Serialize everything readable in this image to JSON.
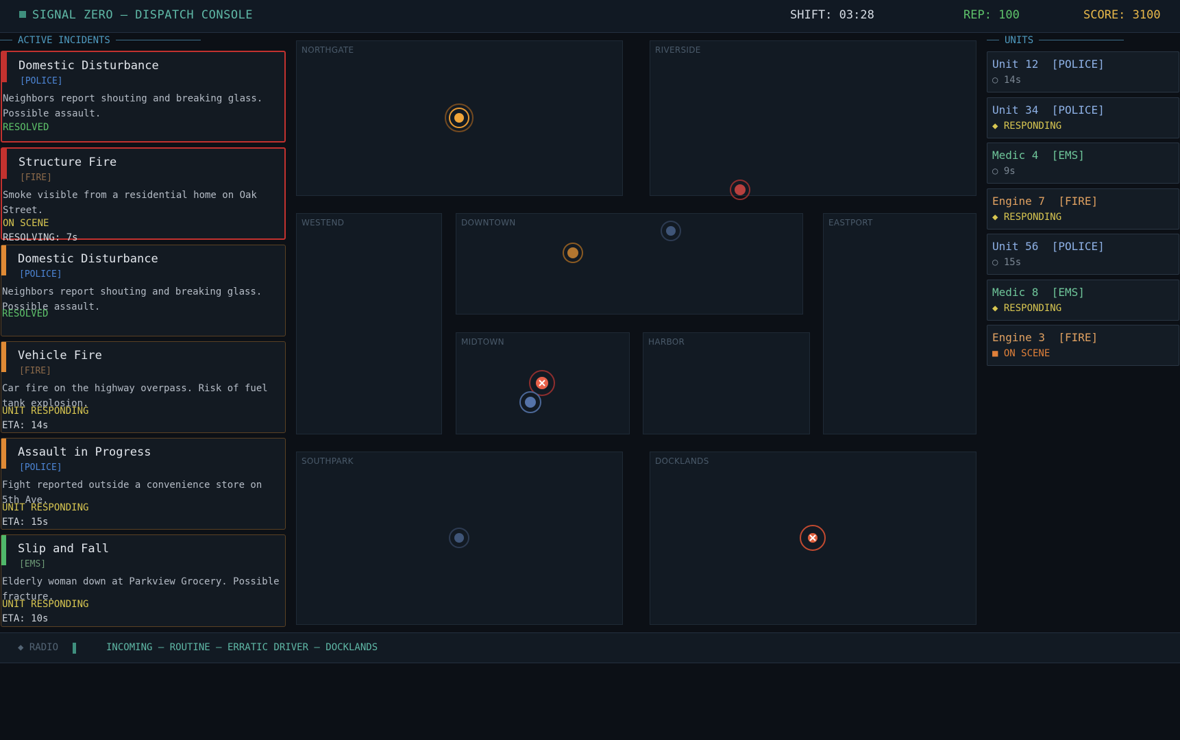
{
  "header": {
    "title": "SIGNAL ZERO — DISPATCH CONSOLE",
    "shift": "SHIFT: 03:28",
    "rep": "REP: 100",
    "score": "SCORE: 3100"
  },
  "incidents_panel": {
    "heading": "ACTIVE INCIDENTS",
    "items": [
      {
        "title": "Domestic Disturbance",
        "type": "[POLICE]",
        "desc": "Neighbors report shouting and breaking glass. Possible assault.",
        "status": "RESOLVED",
        "extra": ""
      },
      {
        "title": "Structure Fire",
        "type": "[FIRE]",
        "desc": "Smoke visible from a residential home on Oak Street.",
        "status": "ON SCENE",
        "extra": "RESOLVING: 7s"
      },
      {
        "title": "Domestic Disturbance",
        "type": "[POLICE]",
        "desc": "Neighbors report shouting and breaking glass. Possible assault.",
        "status": "RESOLVED",
        "extra": ""
      },
      {
        "title": "Vehicle Fire",
        "type": "[FIRE]",
        "desc": "Car fire on the highway overpass. Risk of fuel tank explosion.",
        "status": "UNIT RESPONDING",
        "extra": "ETA: 14s"
      },
      {
        "title": "Assault in Progress",
        "type": "[POLICE]",
        "desc": "Fight reported outside a convenience store on 5th Ave.",
        "status": "UNIT RESPONDING",
        "extra": "ETA: 15s"
      },
      {
        "title": "Slip and Fall",
        "type": "[EMS]",
        "desc": "Elderly woman down at Parkview Grocery. Possible fracture.",
        "status": "UNIT RESPONDING",
        "extra": "ETA: 10s"
      }
    ]
  },
  "map": {
    "districts": [
      "NORTHGATE",
      "RIVERSIDE",
      "WESTEND",
      "DOWNTOWN",
      "EASTPORT",
      "MIDTOWN",
      "HARBOR",
      "SOUTHPARK",
      "DOCKLANDS"
    ]
  },
  "units_panel": {
    "heading": "UNITS",
    "items": [
      {
        "name": "Unit 12  [POLICE]",
        "state": "○ 14s"
      },
      {
        "name": "Unit 34  [POLICE]",
        "state": "◆ RESPONDING"
      },
      {
        "name": "Medic 4  [EMS]",
        "state": "○ 9s"
      },
      {
        "name": "Engine 7  [FIRE]",
        "state": "◆ RESPONDING"
      },
      {
        "name": "Unit 56  [POLICE]",
        "state": "○ 15s"
      },
      {
        "name": "Medic 8  [EMS]",
        "state": "◆ RESPONDING"
      },
      {
        "name": "Engine 3  [FIRE]",
        "state": "■ ON SCENE"
      }
    ]
  },
  "radio": {
    "label": "◆ RADIO",
    "message": "INCOMING — ROUTINE — ERRATIC DRIVER — DOCKLANDS"
  },
  "colors": {
    "police": "#4d86d6",
    "fire": "#e0a161",
    "ems": "#6fc69a",
    "critical": "#c3322f",
    "resolved": "#5ec26a",
    "responding": "#d8c651"
  }
}
